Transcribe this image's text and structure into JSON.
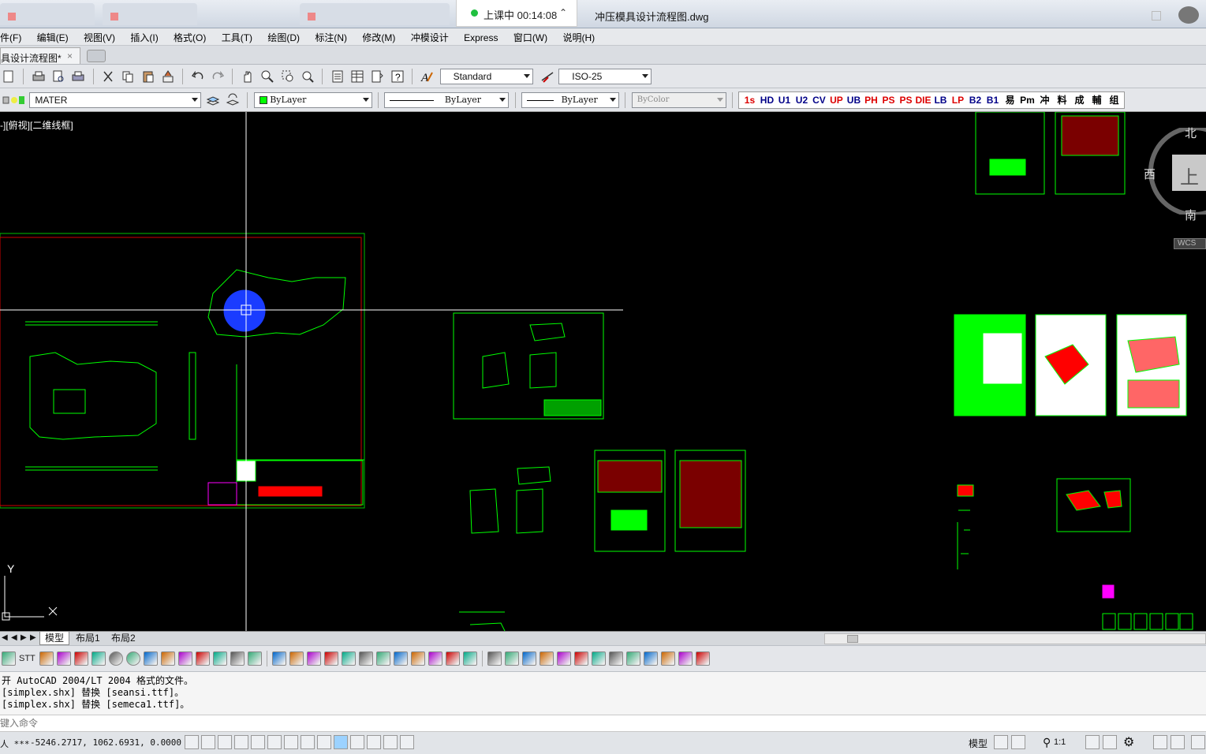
{
  "window": {
    "browser_tab_1": "",
    "browser_tab_2": "",
    "browser_tab_3": "",
    "live_status": "上课中 00:14:08",
    "file_title": "冲压模具设计流程图.dwg"
  },
  "menu": {
    "items": [
      "件(F)",
      "编辑(E)",
      "视图(V)",
      "插入(I)",
      "格式(O)",
      "工具(T)",
      "绘图(D)",
      "标注(N)",
      "修改(M)",
      "冲模设计",
      "Express",
      "窗口(W)",
      "说明(H)"
    ]
  },
  "doc_tab": {
    "label": "具设计流程图*",
    "close": "×"
  },
  "toolbar1": {
    "text_style": "Standard",
    "dim_style": "ISO-25"
  },
  "toolbar2": {
    "layer": "MATER",
    "color": "ByLayer",
    "linetype": "ByLayer",
    "lineweight": "ByLayer",
    "plotstyle": "ByColor",
    "custom_buttons": [
      "1s",
      "HD",
      "U1",
      "U2",
      "CV",
      "UP",
      "UB",
      "PH",
      "PS",
      "PS",
      "DIE",
      "LB",
      "LP",
      "B2",
      "B1",
      "易",
      "Pm",
      "冲",
      "料",
      "成",
      "輔",
      "组"
    ]
  },
  "viewport": {
    "label": "-][俯视][二维线框]",
    "viewcube": {
      "north": "北",
      "south": "南",
      "west": "西",
      "face": "上",
      "wcs": "WCS"
    },
    "ucs": {
      "y": "Y",
      "x": "X"
    }
  },
  "layout_tabs": [
    "模型",
    "布局1",
    "布局2"
  ],
  "toolbar3": {
    "stt": "STT"
  },
  "command": {
    "history": [
      "开 AutoCAD 2004/LT 2004 格式的文件。",
      "[simplex.shx] 替换 [seansi.ttf]。",
      "[simplex.shx] 替换 [semeca1.ttf]。"
    ],
    "prompt": "键入命令"
  },
  "status": {
    "coords": "-5246.2717, 1062.6931, 0.0000",
    "prefix": "人 ***",
    "model_label": "模型",
    "scale": "1:1"
  },
  "colors": {
    "drawing_green": "#00ff00",
    "highlight_blue": "#1a3cff",
    "title_red": "#ff0000",
    "magenta": "#ff00ff"
  }
}
